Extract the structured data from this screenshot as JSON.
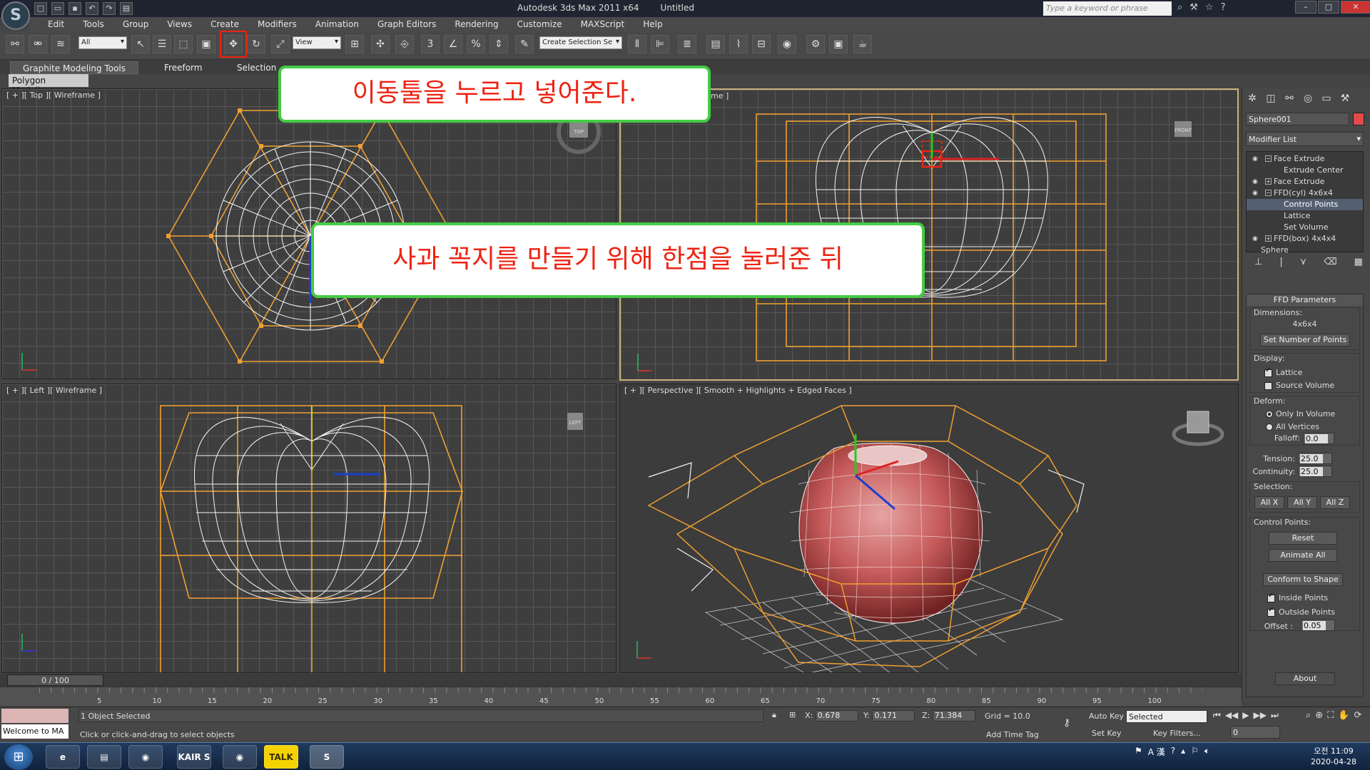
{
  "titlebar": {
    "app_name": "Autodesk 3ds Max  2011 x64",
    "document": "Untitled",
    "search_placeholder": "Type a keyword or phrase",
    "logo": "3ds-max-logo"
  },
  "menu": [
    "Edit",
    "Tools",
    "Group",
    "Views",
    "Create",
    "Modifiers",
    "Animation",
    "Graph Editors",
    "Rendering",
    "Customize",
    "MAXScript",
    "Help"
  ],
  "toolbar": {
    "filter_value": "All",
    "ref_coord_value": "View",
    "selection_set_placeholder": "Create Selection Se",
    "snap_label": "3",
    "angle_snap_label": "%"
  },
  "ribbon": {
    "tabs": [
      "Graphite Modeling Tools",
      "Freeform",
      "Selection"
    ],
    "sub_tab": "Polygon Modeling"
  },
  "viewports": {
    "top": "[ + ][ Top ][ Wireframe ]",
    "front_tail": "me ]",
    "left": "[ + ][ Left ][ Wireframe ]",
    "perspective": "[ + ][ Perspective ][ Smooth + Highlights + Edged Faces ]",
    "top_cube": "TOP",
    "front_cube": "FRONT",
    "left_cube": "LEFT"
  },
  "callouts": {
    "move_tool": "이동툴을 누르고 넣어준다.",
    "stem": "사과 꼭지를 만들기 위해 한점을 눌러준 뒤"
  },
  "command_panel": {
    "object_name": "Sphere001",
    "object_color": "#e24a4a",
    "modifier_list": "Modifier List",
    "stack": [
      {
        "label": "Face Extrude",
        "level": 0,
        "expanded": true,
        "selected": false
      },
      {
        "label": "Extrude Center",
        "level": 1,
        "selected": false
      },
      {
        "label": "Face Extrude",
        "level": 0,
        "expanded": false,
        "selected": false
      },
      {
        "label": "FFD(cyl) 4x6x4",
        "level": 0,
        "expanded": true,
        "selected": false
      },
      {
        "label": "Control Points",
        "level": 1,
        "selected": true
      },
      {
        "label": "Lattice",
        "level": 1,
        "selected": false
      },
      {
        "label": "Set Volume",
        "level": 1,
        "selected": false
      },
      {
        "label": "FFD(box) 4x4x4",
        "level": 0,
        "expanded": false,
        "selected": false
      },
      {
        "label": "Sphere",
        "level": -1,
        "selected": false
      }
    ],
    "ffd": {
      "title": "FFD Parameters",
      "dimensions_label": "Dimensions:",
      "dimensions_value": "4x6x4",
      "set_points_btn": "Set Number of Points",
      "display_label": "Display:",
      "lattice": "Lattice",
      "lattice_checked": true,
      "source_volume": "Source Volume",
      "source_volume_checked": false,
      "deform_label": "Deform:",
      "only_in_volume": "Only In Volume",
      "all_vertices": "All Vertices",
      "falloff_label": "Falloff:",
      "falloff_value": "0.0",
      "tension_label": "Tension:",
      "tension_value": "25.0",
      "continuity_label": "Continuity:",
      "continuity_value": "25.0",
      "selection_label": "Selection:",
      "all_x": "All X",
      "all_y": "All Y",
      "all_z": "All Z",
      "control_points_label": "Control Points:",
      "reset_btn": "Reset",
      "animate_all_btn": "Animate All",
      "conform_btn": "Conform to Shape",
      "inside_points": "Inside Points",
      "outside_points": "Outside Points",
      "offset_label": "Offset :",
      "offset_value": "0.05",
      "about_btn": "About"
    }
  },
  "timeline": {
    "slider": "0 / 100",
    "ticks": [
      "5",
      "10",
      "15",
      "20",
      "25",
      "30",
      "35",
      "40",
      "45",
      "50",
      "55",
      "60",
      "65",
      "70",
      "75",
      "80",
      "85",
      "90",
      "95",
      "100"
    ]
  },
  "status": {
    "selected": "1 Object Selected",
    "prompt": "Click or click-and-drag to select objects",
    "welcome": "Welcome to MA",
    "x_label": "X:",
    "x_value": "0.678",
    "y_label": "Y:",
    "y_value": "0.171",
    "z_label": "Z:",
    "z_value": "71.384",
    "grid": "Grid = 10.0",
    "add_time_tag": "Add Time Tag",
    "auto_key": "Auto Key",
    "set_key": "Set Key",
    "key_mode": "Selected",
    "key_filters": "Key Filters...",
    "frame": "0"
  },
  "taskbar": {
    "apps": [
      "ie-icon",
      "explorer-icon",
      "chrome-icon",
      "kair-icon",
      "chrome-icon",
      "kakaotalk-icon",
      "3dsmax-icon"
    ],
    "kair_label": "KAIR S",
    "talk_label": "TALK",
    "time_period": "오전 11:09",
    "date": "2020-04-28",
    "ime": "A 漢"
  }
}
